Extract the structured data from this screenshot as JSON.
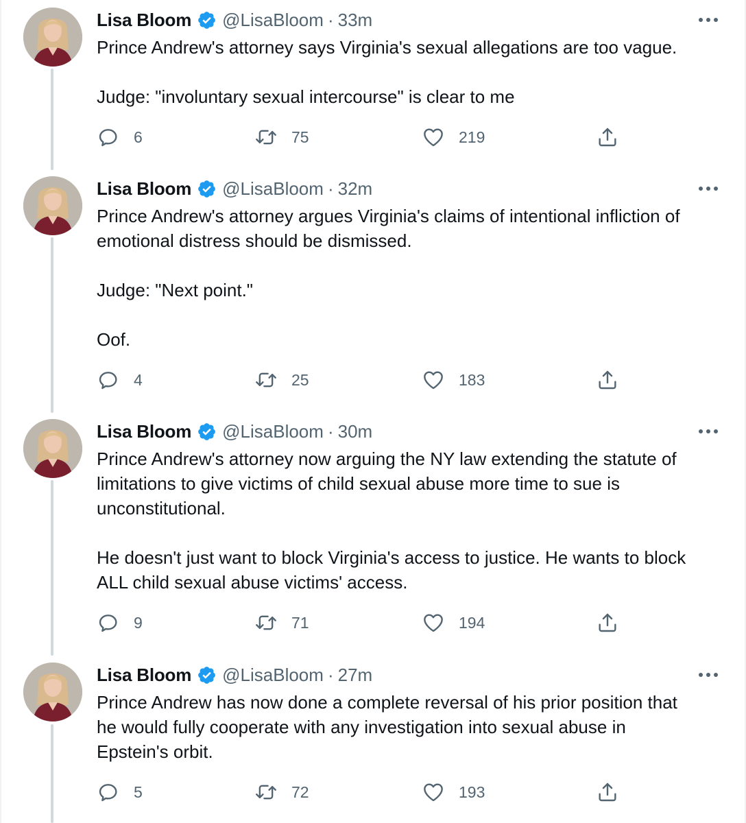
{
  "colors": {
    "accent": "#1d9bf0",
    "secondary_text": "#536471",
    "thread_line": "#cfd9de"
  },
  "tweets": [
    {
      "name": "Lisa Bloom",
      "handle": "@LisaBloom",
      "separator": "·",
      "time": "33m",
      "paragraphs": [
        "Prince Andrew's attorney says Virginia's sexual allegations are too vague.",
        "Judge: \"involuntary sexual intercourse\" is clear to me"
      ],
      "replies": "6",
      "retweets": "75",
      "likes": "219"
    },
    {
      "name": "Lisa Bloom",
      "handle": "@LisaBloom",
      "separator": "·",
      "time": "32m",
      "paragraphs": [
        "Prince Andrew's attorney argues Virginia's claims of intentional infliction of\nemotional distress should be dismissed.",
        "Judge: \"Next point.\"",
        "Oof."
      ],
      "replies": "4",
      "retweets": "25",
      "likes": "183"
    },
    {
      "name": "Lisa Bloom",
      "handle": "@LisaBloom",
      "separator": "·",
      "time": "30m",
      "paragraphs": [
        "Prince Andrew's attorney now arguing the NY law extending the statute of\nlimitations to give victims of child sexual abuse more time to sue is\nunconstitutional.",
        "He doesn't just want to block Virginia's access to justice. He wants to block\nALL child sexual abuse victims' access."
      ],
      "replies": "9",
      "retweets": "71",
      "likes": "194"
    },
    {
      "name": "Lisa Bloom",
      "handle": "@LisaBloom",
      "separator": "·",
      "time": "27m",
      "paragraphs": [
        "Prince Andrew has now done a complete reversal of his prior position that\nhe would fully cooperate with any investigation into sexual abuse in\nEpstein's orbit."
      ],
      "replies": "5",
      "retweets": "72",
      "likes": "193"
    }
  ]
}
